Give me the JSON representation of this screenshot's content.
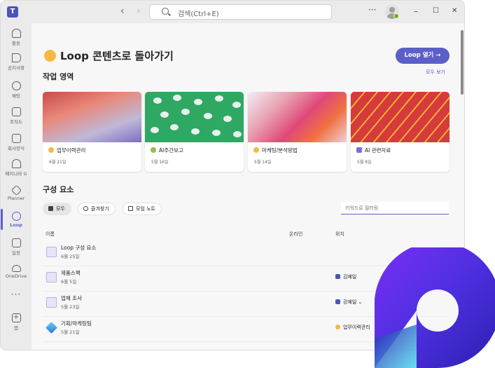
{
  "titlebar": {
    "app_name": "Microsoft Teams",
    "search_placeholder": "검색(Ctrl+E)",
    "more": "···",
    "minimize": "–",
    "maximize": "☐",
    "close": "✕"
  },
  "rail": {
    "items": [
      {
        "label": "활동",
        "icon": "bell-icon"
      },
      {
        "label": "공지사항",
        "icon": "megaphone-icon"
      },
      {
        "label": "채팅",
        "icon": "chat-icon"
      },
      {
        "label": "조직도",
        "icon": "org-chart-icon"
      },
      {
        "label": "회사양식",
        "icon": "form-icon"
      },
      {
        "label": "페이나라 G",
        "icon": "plant-icon"
      },
      {
        "label": "Planner",
        "icon": "planner-icon"
      },
      {
        "label": "Loop",
        "icon": "loop-icon"
      },
      {
        "label": "일정",
        "icon": "calendar-icon"
      },
      {
        "label": "OneDrive",
        "icon": "cloud-icon"
      }
    ],
    "more": "···",
    "apps_label": "앱"
  },
  "main": {
    "title": "Loop 콘텐츠로 돌아가기",
    "open_loop_button": "Loop 열기 →",
    "workspaces": {
      "title": "작업 영역",
      "see_all": "모두 보기",
      "cards": [
        {
          "name": "업무이력관리",
          "date": "6월 21일",
          "dot_color": "#f5b942"
        },
        {
          "name": "AI주간보고",
          "date": "5월 16일",
          "dot_color": "#8bc34a"
        },
        {
          "name": "마케팅/분석방법",
          "date": "5월 14일",
          "dot_color": "#f5b942"
        },
        {
          "name": "AI 관련자료",
          "date": "5월 6일",
          "dot_color": "#7c6fd8"
        }
      ]
    },
    "components": {
      "title": "구성 요소",
      "filters": [
        "모두",
        "즐겨찾기",
        "모임 노트"
      ],
      "filter_placeholder": "키워드로 필터링",
      "columns": {
        "name": "이름",
        "online": "온라인",
        "location": "위치"
      },
      "rows": [
        {
          "name": "Loop 구성 요소",
          "date": "6월 25일",
          "location": ""
        },
        {
          "name": "제품스펙",
          "date": "6월 5일",
          "location": "김예일"
        },
        {
          "name": "업체 조사",
          "date": "5월 23일",
          "location": "강예일 ⌄"
        },
        {
          "name": "기획/마케팅팀",
          "date": "5월 21일",
          "location": "업무이력관리"
        }
      ]
    }
  }
}
